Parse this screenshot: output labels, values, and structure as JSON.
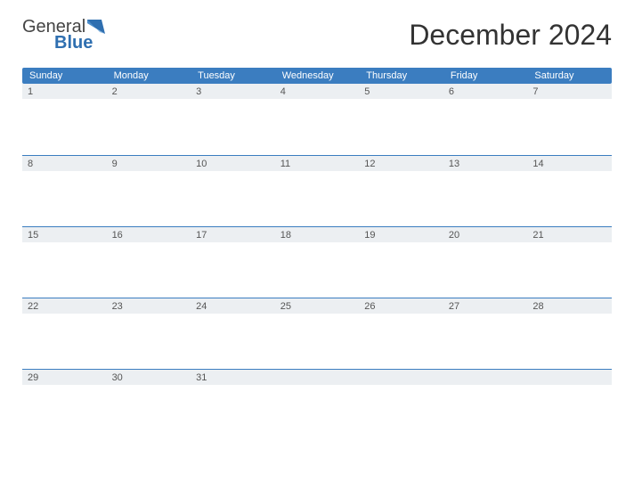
{
  "logo": {
    "text1": "General",
    "text2": "Blue",
    "accent_color": "#2f6fb0"
  },
  "title": "December 2024",
  "calendar": {
    "day_headers": [
      "Sunday",
      "Monday",
      "Tuesday",
      "Wednesday",
      "Thursday",
      "Friday",
      "Saturday"
    ],
    "weeks": [
      [
        "1",
        "2",
        "3",
        "4",
        "5",
        "6",
        "7"
      ],
      [
        "8",
        "9",
        "10",
        "11",
        "12",
        "13",
        "14"
      ],
      [
        "15",
        "16",
        "17",
        "18",
        "19",
        "20",
        "21"
      ],
      [
        "22",
        "23",
        "24",
        "25",
        "26",
        "27",
        "28"
      ],
      [
        "29",
        "30",
        "31",
        "",
        "",
        "",
        ""
      ]
    ]
  },
  "colors": {
    "header_blue": "#3b7dc0",
    "band_gray": "#eceff2"
  }
}
